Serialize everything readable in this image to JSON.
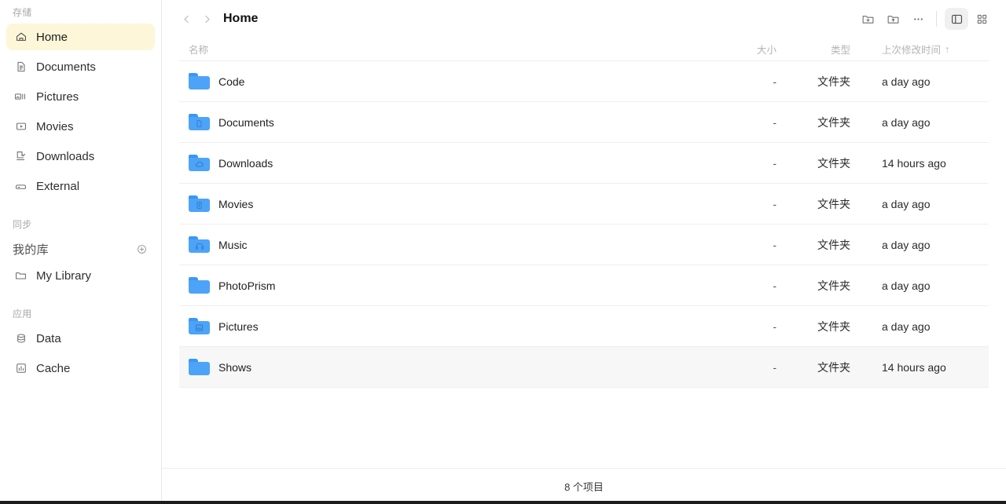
{
  "sidebar": {
    "sections": [
      {
        "title": "存储",
        "items": [
          {
            "label": "Home",
            "icon": "home-icon",
            "active": true
          },
          {
            "label": "Documents",
            "icon": "document-icon",
            "active": false
          },
          {
            "label": "Pictures",
            "icon": "pictures-icon",
            "active": false
          },
          {
            "label": "Movies",
            "icon": "movies-icon",
            "active": false
          },
          {
            "label": "Downloads",
            "icon": "download-icon",
            "active": false
          },
          {
            "label": "External",
            "icon": "external-drive-icon",
            "active": false
          }
        ]
      },
      {
        "title": "同步",
        "library_label": "我的库",
        "add_icon": "plus-circle-icon",
        "items": [
          {
            "label": "My Library",
            "icon": "folder-icon",
            "active": false
          }
        ]
      },
      {
        "title": "应用",
        "items": [
          {
            "label": "Data",
            "icon": "database-icon",
            "active": false
          },
          {
            "label": "Cache",
            "icon": "chart-box-icon",
            "active": false
          }
        ]
      }
    ]
  },
  "header": {
    "back_icon": "chevron-left-icon",
    "forward_icon": "chevron-right-icon",
    "breadcrumb": "Home",
    "tools": [
      {
        "name": "new-folder-icon",
        "label": "新建文件夹"
      },
      {
        "name": "folder-upload-icon",
        "label": "上传到文件夹"
      },
      {
        "name": "more-options-icon",
        "label": "更多"
      }
    ],
    "view_toggles": [
      {
        "name": "sidebar-toggle-icon",
        "active": true
      },
      {
        "name": "grid-view-icon",
        "active": false
      }
    ]
  },
  "table": {
    "columns": {
      "name": "名称",
      "size": "大小",
      "type": "类型",
      "modified": "上次修改时间",
      "sort_indicator": "↑"
    },
    "rows": [
      {
        "name": "Code",
        "size": "-",
        "type": "文件夹",
        "modified": "a day ago",
        "glyph": "",
        "selected": false
      },
      {
        "name": "Documents",
        "size": "-",
        "type": "文件夹",
        "modified": "a day ago",
        "glyph": "doc",
        "selected": false
      },
      {
        "name": "Downloads",
        "size": "-",
        "type": "文件夹",
        "modified": "14 hours ago",
        "glyph": "cloud",
        "selected": false
      },
      {
        "name": "Movies",
        "size": "-",
        "type": "文件夹",
        "modified": "a day ago",
        "glyph": "film",
        "selected": false
      },
      {
        "name": "Music",
        "size": "-",
        "type": "文件夹",
        "modified": "a day ago",
        "glyph": "music",
        "selected": false
      },
      {
        "name": "PhotoPrism",
        "size": "-",
        "type": "文件夹",
        "modified": "a day ago",
        "glyph": "",
        "selected": false
      },
      {
        "name": "Pictures",
        "size": "-",
        "type": "文件夹",
        "modified": "a day ago",
        "glyph": "image",
        "selected": false
      },
      {
        "name": "Shows",
        "size": "-",
        "type": "文件夹",
        "modified": "14 hours ago",
        "glyph": "",
        "selected": true
      }
    ]
  },
  "status": {
    "item_count_label": "8 个项目"
  },
  "colors": {
    "accent_folder": "#4da3f7",
    "active_nav": "#fdf6d8",
    "selected_row": "#f7f7f7"
  }
}
